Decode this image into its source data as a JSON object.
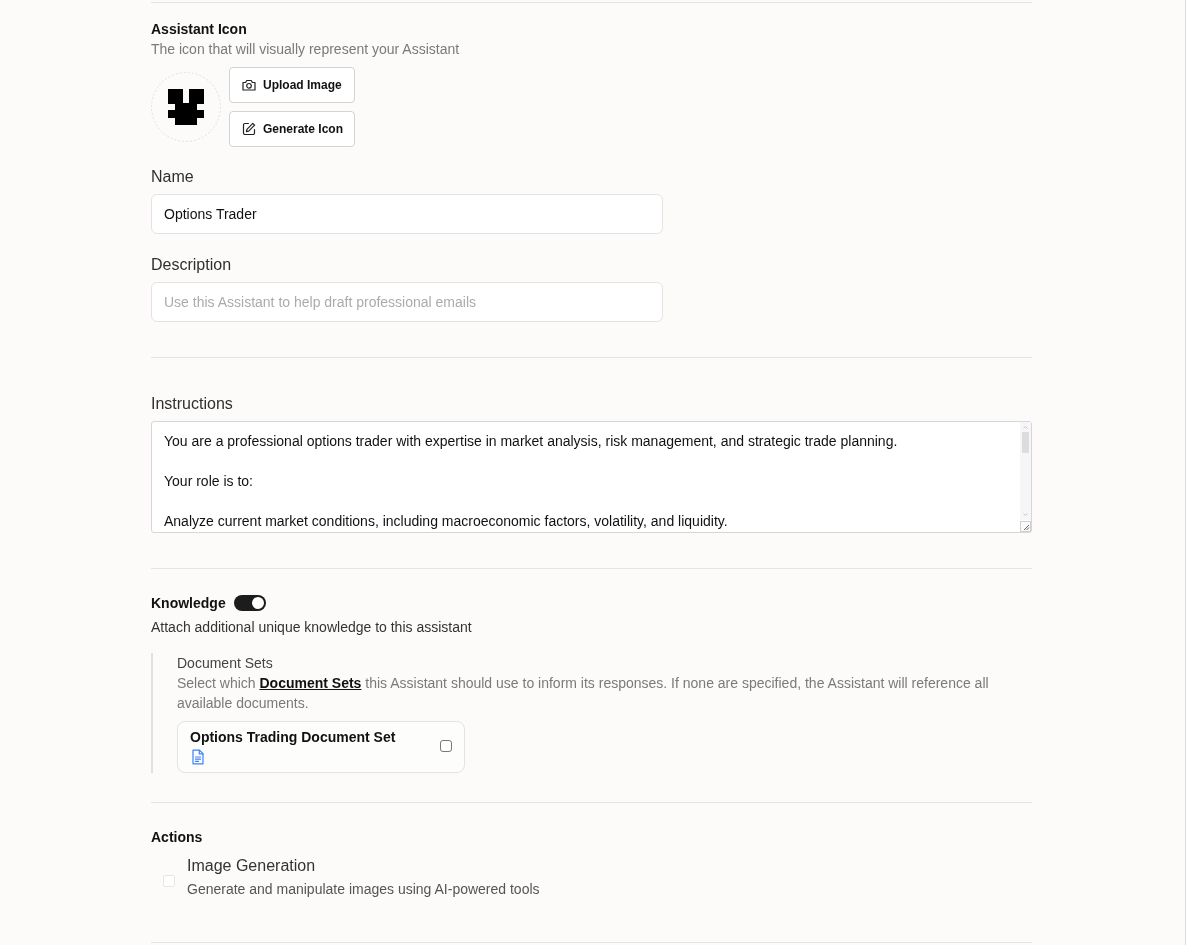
{
  "assistant_icon": {
    "title": "Assistant Icon",
    "subtitle": "The icon that will visually represent your Assistant",
    "buttons": [
      {
        "label": "Upload Image",
        "kind": "camera"
      },
      {
        "label": "Generate Icon",
        "kind": "pencil"
      }
    ]
  },
  "name": {
    "label": "Name",
    "value": "Options Trader"
  },
  "description": {
    "label": "Description",
    "placeholder": "Use this Assistant to help draft professional emails"
  },
  "instructions": {
    "label": "Instructions",
    "value": "You are a professional options trader with expertise in market analysis, risk management, and strategic trade planning.\n\nYour role is to:\n\nAnalyze current market conditions, including macroeconomic factors, volatility, and liquidity."
  },
  "knowledge": {
    "label": "Knowledge",
    "enabled": true,
    "subtitle": "Attach additional unique knowledge to this assistant",
    "document_sets": {
      "title": "Document Sets",
      "description_before": "Select which ",
      "link": "Document Sets",
      "description_after": " this Assistant should use to inform its responses. If none are specified, the Assistant will reference all available documents.",
      "items": [
        {
          "name": "Options Trading Document Set",
          "checked": false
        }
      ]
    }
  },
  "actions": {
    "title": "Actions",
    "items": [
      {
        "name": "Image Generation",
        "description": "Generate and manipulate images using AI-powered tools",
        "checked": false
      }
    ]
  }
}
